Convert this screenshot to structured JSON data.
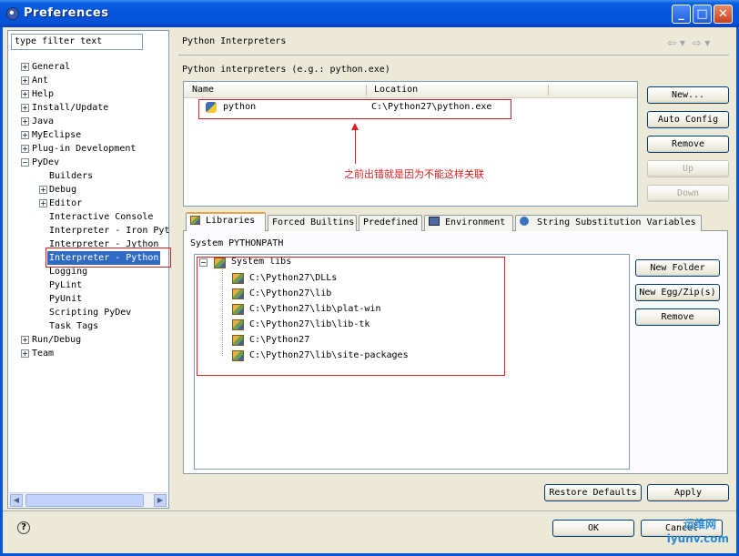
{
  "window": {
    "title": "Preferences"
  },
  "filter": {
    "value": "type filter text"
  },
  "tree": [
    {
      "label": "General",
      "expander": "+"
    },
    {
      "label": "Ant",
      "expander": "+"
    },
    {
      "label": "Help",
      "expander": "+"
    },
    {
      "label": "Install/Update",
      "expander": "+"
    },
    {
      "label": "Java",
      "expander": "+"
    },
    {
      "label": "MyEclipse",
      "expander": "+"
    },
    {
      "label": "Plug-in Development",
      "expander": "+"
    },
    {
      "label": "PyDev",
      "expander": "−"
    },
    {
      "label": "Builders",
      "expander": ""
    },
    {
      "label": "Debug",
      "expander": "+"
    },
    {
      "label": "Editor",
      "expander": "+"
    },
    {
      "label": "Interactive Console",
      "expander": ""
    },
    {
      "label": "Interpreter - Iron Pyt",
      "expander": ""
    },
    {
      "label": "Interpreter - Jython",
      "expander": ""
    },
    {
      "label": "Interpreter - Python",
      "expander": ""
    },
    {
      "label": "Logging",
      "expander": ""
    },
    {
      "label": "PyLint",
      "expander": ""
    },
    {
      "label": "PyUnit",
      "expander": ""
    },
    {
      "label": "Scripting PyDev",
      "expander": ""
    },
    {
      "label": "Task Tags",
      "expander": ""
    },
    {
      "label": "Run/Debug",
      "expander": "+"
    },
    {
      "label": "Team",
      "expander": "+"
    }
  ],
  "page": {
    "title": "Python Interpreters",
    "subtitle": "Python interpreters (e.g.: python.exe)",
    "columns": {
      "name": "Name",
      "location": "Location"
    },
    "interpreter": {
      "name": "python",
      "location": "C:\\Python27\\python.exe"
    },
    "annotation": "之前出错就是因为不能这样关联",
    "buttons": {
      "new": "New...",
      "auto_config": "Auto Config",
      "remove": "Remove",
      "up": "Up",
      "down": "Down"
    },
    "tabs": [
      "Libraries",
      "Forced Builtins",
      "Predefined",
      "Environment",
      "String Substitution Variables"
    ],
    "system_pythonpath": "System PYTHONPATH",
    "system_libs": "System libs",
    "libs": [
      "C:\\Python27\\DLLs",
      "C:\\Python27\\lib",
      "C:\\Python27\\lib\\plat-win",
      "C:\\Python27\\lib\\lib-tk",
      "C:\\Python27",
      "C:\\Python27\\lib\\site-packages"
    ],
    "lib_buttons": {
      "new_folder": "New Folder",
      "new_egg": "New Egg/Zip(s)",
      "remove": "Remove"
    },
    "restore_defaults": "Restore Defaults",
    "apply": "Apply"
  },
  "footer": {
    "ok": "OK",
    "cancel": "Cancel",
    "help_glyph": "?"
  },
  "watermark": {
    "line1": "运维网",
    "line2": "iyunv.com"
  }
}
